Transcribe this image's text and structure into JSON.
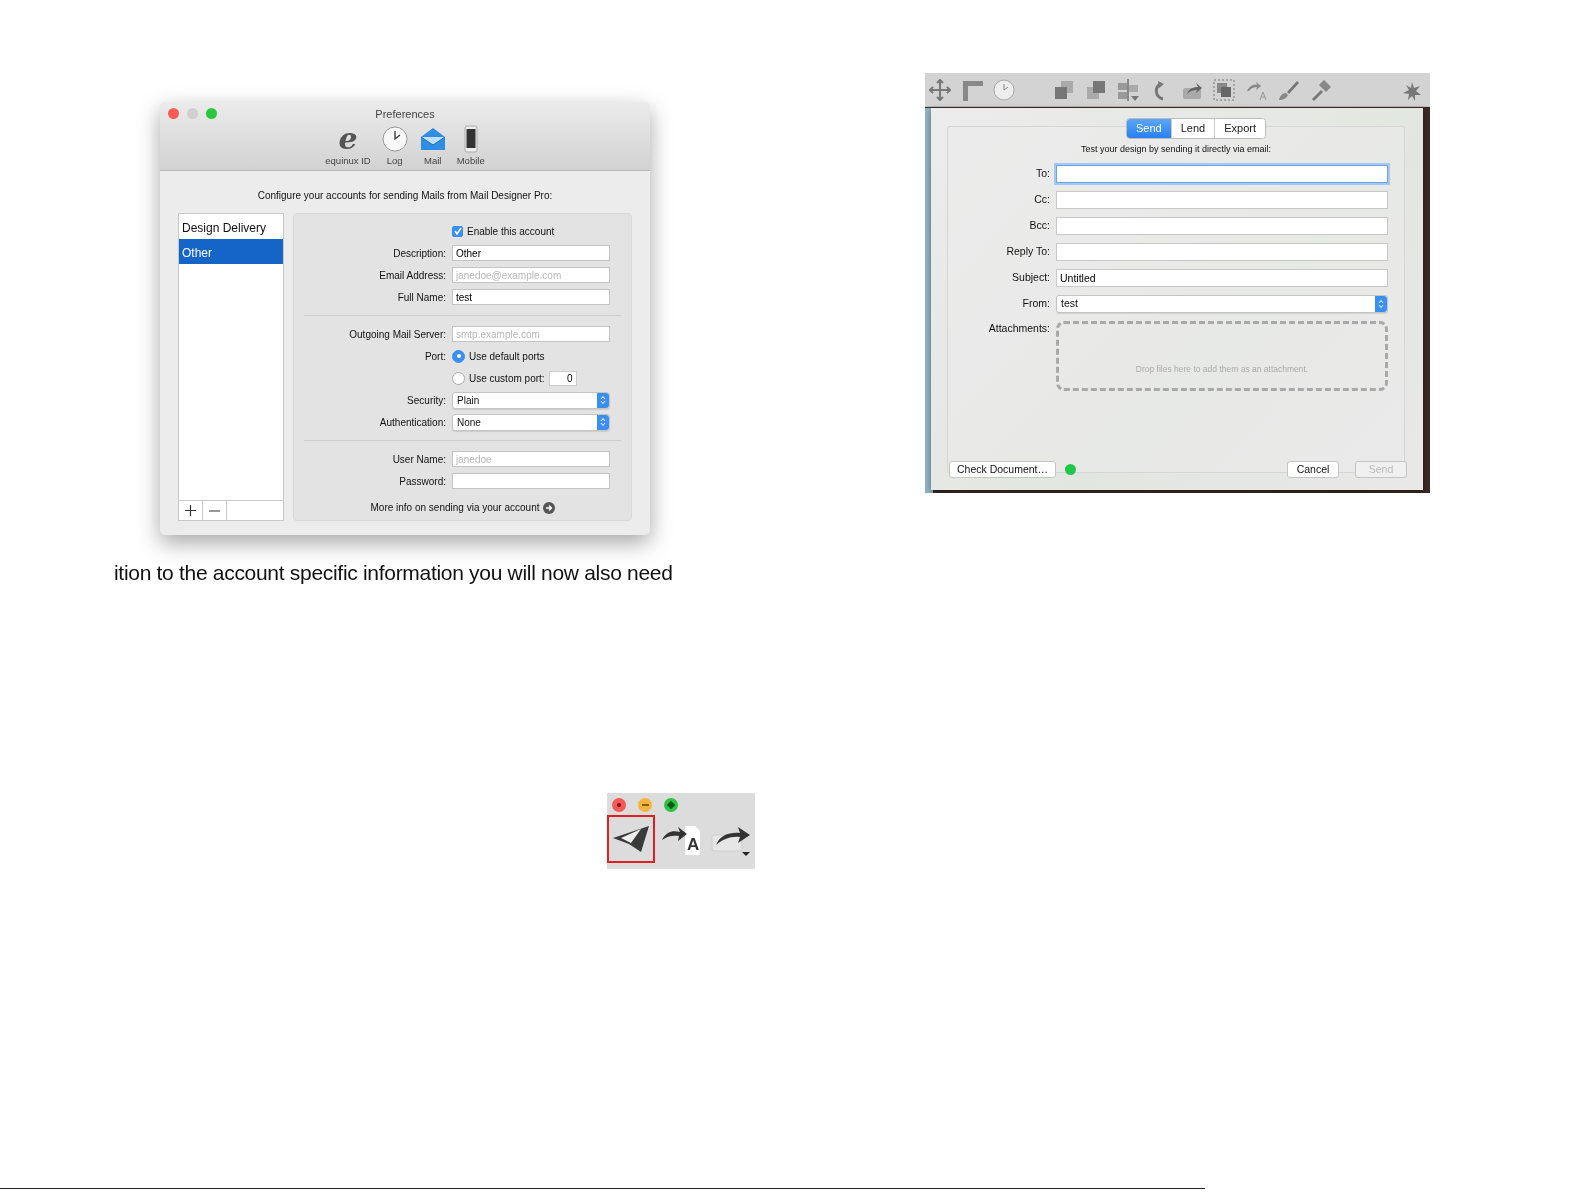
{
  "preferences_window": {
    "title": "Preferences",
    "toolbar": [
      {
        "kind": "glyph",
        "glyph": "e",
        "label": "equinux ID"
      },
      {
        "kind": "clock",
        "label": "Log"
      },
      {
        "kind": "mail",
        "label": "Mail"
      },
      {
        "kind": "phone",
        "label": "Mobile"
      }
    ],
    "intro": "Configure your accounts for sending Mails from Mail Designer Pro:",
    "accounts": [
      {
        "label": "Design Delivery",
        "selected": false
      },
      {
        "label": "Other",
        "selected": true
      }
    ],
    "form": [
      {
        "kind": "checkbox",
        "option": "Enable this account",
        "checked": true
      },
      {
        "kind": "text",
        "label": "Description:",
        "value": "Other"
      },
      {
        "kind": "text",
        "label": "Email Address:",
        "placeholder": "janedoe@example.com"
      },
      {
        "kind": "text",
        "label": "Full Name:",
        "value": "test"
      },
      {
        "kind": "divider"
      },
      {
        "kind": "text",
        "label": "Outgoing Mail Server:",
        "placeholder": "smtp.example.com"
      },
      {
        "kind": "radio",
        "label": "Port:",
        "option": "Use default ports",
        "selected": true
      },
      {
        "kind": "radio",
        "option": "Use custom port:",
        "selected": false,
        "value": "0"
      },
      {
        "kind": "select",
        "label": "Security:",
        "value": "Plain"
      },
      {
        "kind": "select",
        "label": "Authentication:",
        "value": "None"
      },
      {
        "kind": "divider"
      },
      {
        "kind": "text",
        "label": "User Name:",
        "placeholder": "janedoe"
      },
      {
        "kind": "text",
        "label": "Password:"
      }
    ],
    "link": "More info on sending via your account"
  },
  "caption_fragment": "ition to the account specific information you will now also need",
  "send_dialog": {
    "tabs": [
      {
        "label": "Send",
        "selected": true
      },
      {
        "label": "Lend",
        "selected": false
      },
      {
        "label": "Export",
        "selected": false
      }
    ],
    "intro": "Test your design by sending it directly via email:",
    "fields": [
      {
        "kind": "text",
        "label": "To:",
        "focused": true
      },
      {
        "kind": "text",
        "label": "Cc:",
        "focused": false
      },
      {
        "kind": "text",
        "label": "Bcc:",
        "focused": false
      },
      {
        "kind": "text",
        "label": "Reply To:",
        "focused": false
      },
      {
        "kind": "text",
        "label": "Subject:",
        "value": "Untitled",
        "focused": false
      },
      {
        "kind": "select",
        "label": "From:",
        "value": "test"
      },
      {
        "kind": "drop",
        "label": "Attachments:",
        "hint": "Drop files here to add them as an attachment."
      }
    ],
    "check_button": "Check Document…",
    "buttons": [
      {
        "label": "Cancel",
        "disabled": false
      },
      {
        "label": "Send",
        "disabled": true
      }
    ]
  },
  "toolbar_snippet": {
    "tools": [
      {
        "kind": "send",
        "highlighted": true
      },
      {
        "kind": "text-share",
        "glyph": "A",
        "highlighted": false
      },
      {
        "kind": "share-menu",
        "highlighted": false
      }
    ]
  }
}
